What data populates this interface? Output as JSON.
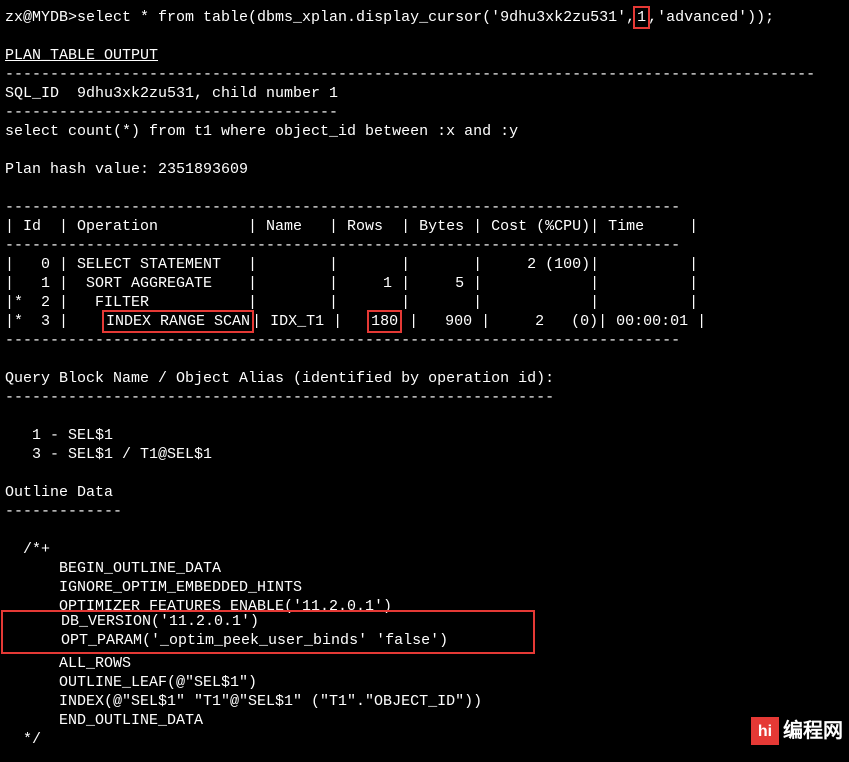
{
  "prompt": "zx@MYDB>",
  "command_pre": "select * from table(dbms_xplan.display_cursor('9dhu3xk2zu531',",
  "command_hl": "1",
  "command_post": ",'advanced'));",
  "plan_output_hdr": "PLAN_TABLE_OUTPUT",
  "hr": "------------------------------------------------------------------------------------------",
  "sqlid_line": "SQL_ID  9dhu3xk2zu531, child number 1",
  "sqlid_dash": "-------------------------------------",
  "query_text": "select count(*) from t1 where object_id between :x and :y",
  "planhash": "Plan hash value: 2351893609",
  "table_hr": "---------------------------------------------------------------------------",
  "table_hdr": "| Id  | Operation          | Name   | Rows  | Bytes | Cost (%CPU)| Time     |",
  "row0": "|   0 | SELECT STATEMENT   |        |       |       |     2 (100)|          |",
  "row1": "|   1 |  SORT AGGREGATE    |        |     1 |     5 |            |          |",
  "row2_pre": "|*  2 |   ",
  "row2_filter": "FILTER",
  "row2_post": "           |        |       |       |            |          |",
  "row3_pre": "|*  3 |    ",
  "row3_op": "INDEX RANGE SCAN",
  "row3_mid1": "| IDX_T1 |   ",
  "row3_rows": "180",
  "row3_post": " |   900 |     2   (0)| 00:00:01 |",
  "qblock_title": "Query Block Name / Object Alias (identified by operation id):",
  "qblock_dash": "-------------------------------------------------------------",
  "qblock1": "   1 - SEL$1",
  "qblock3": "   3 - SEL$1 / T1@SEL$1",
  "outline_title": "Outline Data",
  "outline_dash": "-------------",
  "hint_open": "  /*+",
  "hint1": "      BEGIN_OUTLINE_DATA",
  "hint2": "      IGNORE_OPTIM_EMBEDDED_HINTS",
  "hint3": "      OPTIMIZER_FEATURES_ENABLE('11.2.0.1')",
  "hint4_pre": "      ",
  "hint4": "DB_VERSION('11.2.0.1')",
  "hint5_pre": "      ",
  "hint5": "OPT_PARAM('_optim_peek_user_binds' 'false')",
  "hint5_pad": "   ",
  "hint6": "      ALL_ROWS",
  "hint7": "      OUTLINE_LEAF(@\"SEL$1\")",
  "hint8": "      INDEX(@\"SEL$1\" \"T1\"@\"SEL$1\" (\"T1\".\"OBJECT_ID\"))",
  "hint9": "      END_OUTLINE_DATA",
  "hint_close": "  */",
  "wm_icon": "hi",
  "wm_text": "编程网"
}
